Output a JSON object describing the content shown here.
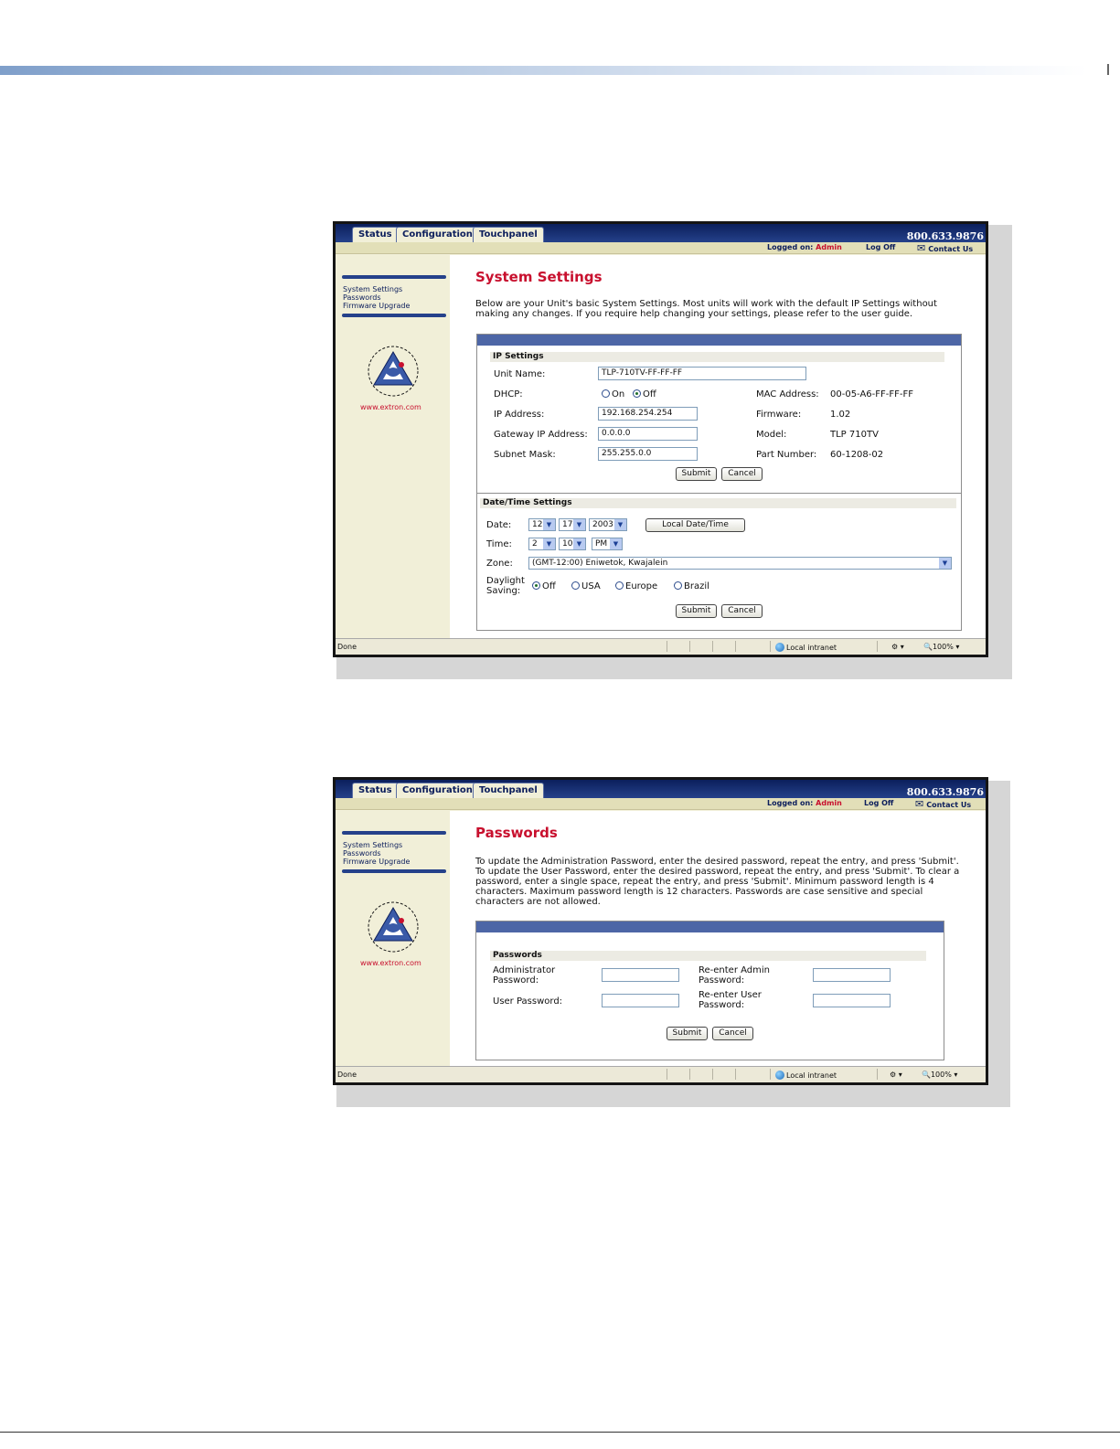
{
  "shot1": {
    "tabs": [
      "Status",
      "Configuration",
      "Touchpanel"
    ],
    "phone": "800.633.9876",
    "logged_on_label": "Logged on:",
    "logged_on_user": "Admin",
    "log_off": "Log Off",
    "contact_us": "Contact Us",
    "sidebar": {
      "items": [
        "System Settings",
        "Passwords",
        "Firmware Upgrade"
      ],
      "site": "www.extron.com"
    },
    "title": "System Settings",
    "intro": "Below are your Unit's basic System Settings. Most units will work with the default IP Settings without making any changes. If you require help changing your settings, please refer to the user guide.",
    "ip_settings": {
      "heading": "IP Settings",
      "unit_name_label": "Unit Name:",
      "unit_name_value": "TLP-710TV-FF-FF-FF",
      "dhcp_label": "DHCP:",
      "dhcp_on": "On",
      "dhcp_off": "Off",
      "ip_label": "IP Address:",
      "ip_value": "192.168.254.254",
      "gateway_label": "Gateway IP Address:",
      "gateway_value": "0.0.0.0",
      "subnet_label": "Subnet Mask:",
      "subnet_value": "255.255.0.0",
      "mac_label": "MAC Address:",
      "mac_value": "00-05-A6-FF-FF-FF",
      "firmware_label": "Firmware:",
      "firmware_value": "1.02",
      "model_label": "Model:",
      "model_value": "TLP 710TV",
      "part_label": "Part Number:",
      "part_value": "60-1208-02",
      "submit": "Submit",
      "cancel": "Cancel"
    },
    "datetime": {
      "heading": "Date/Time Settings",
      "date_label": "Date:",
      "date_month": "12",
      "date_day": "17",
      "date_year": "2003",
      "local_btn": "Local Date/Time",
      "time_label": "Time:",
      "time_hour": "2",
      "time_min": "10",
      "time_ampm": "PM",
      "zone_label": "Zone:",
      "zone_value": "(GMT-12:00) Eniwetok, Kwajalein",
      "dst_label_1": "Daylight",
      "dst_label_2": "Saving:",
      "dst_options": [
        "Off",
        "USA",
        "Europe",
        "Brazil"
      ],
      "submit": "Submit",
      "cancel": "Cancel"
    },
    "status": {
      "done": "Done",
      "zone": "Local intranet",
      "zoom": "100%"
    }
  },
  "shot2": {
    "tabs": [
      "Status",
      "Configuration",
      "Touchpanel"
    ],
    "phone": "800.633.9876",
    "logged_on_label": "Logged on:",
    "logged_on_user": "Admin",
    "log_off": "Log Off",
    "contact_us": "Contact Us",
    "sidebar": {
      "items": [
        "System Settings",
        "Passwords",
        "Firmware Upgrade"
      ],
      "site": "www.extron.com"
    },
    "title": "Passwords",
    "intro": "To update the Administration Password, enter the desired password, repeat the entry, and press 'Submit'. To update the User Password, enter the desired password, repeat the entry, and press 'Submit'. To clear a password, enter a single space, repeat the entry, and press 'Submit'. Minimum password length is 4 characters. Maximum password length is 12 characters. Passwords are case sensitive and special characters are not allowed.",
    "passwords": {
      "heading": "Passwords",
      "admin_label_1": "Administrator",
      "admin_label_2": "Password:",
      "reenter_admin_1": "Re-enter Admin",
      "reenter_admin_2": "Password:",
      "user_label": "User Password:",
      "reenter_user_1": "Re-enter User",
      "reenter_user_2": "Password:",
      "submit": "Submit",
      "cancel": "Cancel"
    },
    "status": {
      "done": "Done",
      "zone": "Local intranet",
      "zoom": "100%"
    }
  }
}
